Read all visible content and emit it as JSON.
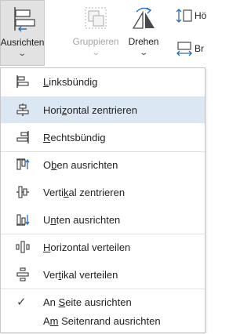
{
  "colors": {
    "accent_blue": "#2b6cb8",
    "icon_gray": "#4a4a4a",
    "highlight": "#dce7f4",
    "disabled_text": "#a6a6a6"
  },
  "ribbon": {
    "ausrichten": {
      "label": "Ausrichten",
      "icon": "align-icon",
      "chevron": "⌄"
    },
    "gruppieren": {
      "label": "Gruppieren",
      "icon": "group-icon",
      "chevron": "⌄",
      "disabled": true
    },
    "drehen": {
      "label": "Drehen",
      "icon": "rotate-icon",
      "chevron": "⌄"
    },
    "hoehe": {
      "label": "Hö",
      "icon": "height-icon"
    },
    "breite": {
      "label": "Br",
      "icon": "width-icon"
    }
  },
  "menu": {
    "items": [
      {
        "pre": "",
        "acc": "L",
        "post": "inksbündig",
        "icon": "align-left-icon"
      },
      {
        "pre": "Hori",
        "acc": "z",
        "post": "ontal zentrieren",
        "icon": "align-center-icon",
        "highlighted": true
      },
      {
        "pre": "",
        "acc": "R",
        "post": "echtsbündig",
        "icon": "align-right-icon"
      },
      {
        "pre": "O",
        "acc": "b",
        "post": "en ausrichten",
        "icon": "align-top-icon"
      },
      {
        "pre": "Verti",
        "acc": "k",
        "post": "al zentrieren",
        "icon": "align-middle-icon"
      },
      {
        "pre": "U",
        "acc": "n",
        "post": "ten ausrichten",
        "icon": "align-bottom-icon"
      },
      {
        "pre": "",
        "acc": "H",
        "post": "orizontal verteilen",
        "icon": "distribute-horizontal-icon"
      },
      {
        "pre": "Ver",
        "acc": "t",
        "post": "ikal verteilen",
        "icon": "distribute-vertical-icon"
      },
      {
        "pre": "An ",
        "acc": "S",
        "post": "eite ausrichten",
        "checked": true,
        "check_glyph": "✓"
      },
      {
        "pre": "A",
        "acc": "m",
        "post": " Seitenrand ausrichten"
      }
    ]
  }
}
